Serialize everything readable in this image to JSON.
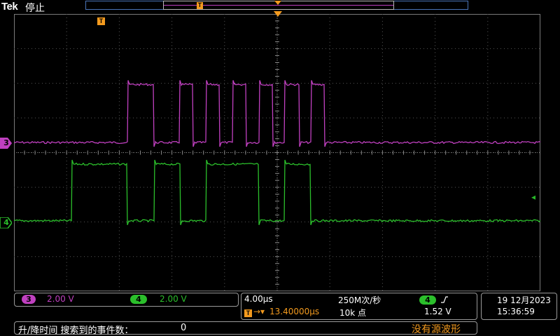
{
  "header": {
    "brand": "Tek",
    "status": "停止"
  },
  "markers": {
    "trigger_badge": "T",
    "ch3": "3",
    "ch4": "4",
    "ch3_color": "#c040c0",
    "ch4_color": "#2bbf2b",
    "trigger_color": "#f39a1e"
  },
  "channels": {
    "ch3_num": "3",
    "ch3_scale": "2.00 V",
    "ch4_num": "4",
    "ch4_scale": "2.00 V"
  },
  "horizontal": {
    "timebase": "4.00µs",
    "sample_rate": "250M次/秒",
    "trigger_delay": "13.40000µs",
    "record_length": "10k 点",
    "trigger_source": "4",
    "trigger_slope_icon": "rising-edge-icon",
    "trigger_level": "1.52 V"
  },
  "clock": {
    "date": "19 12月2023",
    "time": "15:36:59"
  },
  "search": {
    "label": "升/降时间 搜索到的事件数：",
    "count": "0",
    "message": "没有源波形"
  },
  "waveforms": {
    "ch3": {
      "label": "Channel 3",
      "high_v": 4.8,
      "low_v": 0,
      "pulses": 8
    },
    "ch4": {
      "label": "Channel 4",
      "high_v": 4.8,
      "low_v": 0,
      "pulses": 4
    }
  }
}
